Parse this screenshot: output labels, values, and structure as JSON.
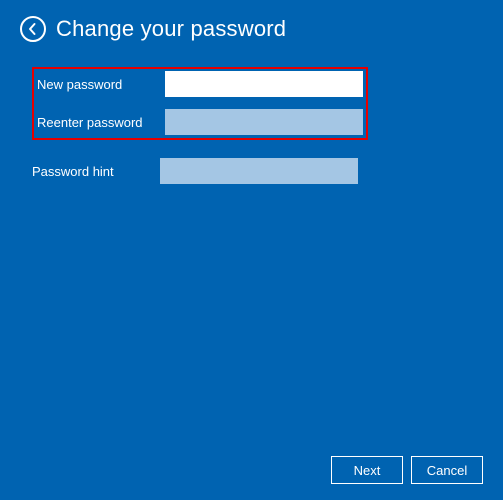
{
  "header": {
    "title": "Change your password",
    "back_icon": "back-arrow"
  },
  "form": {
    "new_password": {
      "label": "New password",
      "value": "",
      "placeholder": ""
    },
    "reenter_password": {
      "label": "Reenter password",
      "value": "",
      "placeholder": ""
    },
    "password_hint": {
      "label": "Password hint",
      "value": "",
      "placeholder": ""
    }
  },
  "footer": {
    "next_label": "Next",
    "cancel_label": "Cancel"
  }
}
